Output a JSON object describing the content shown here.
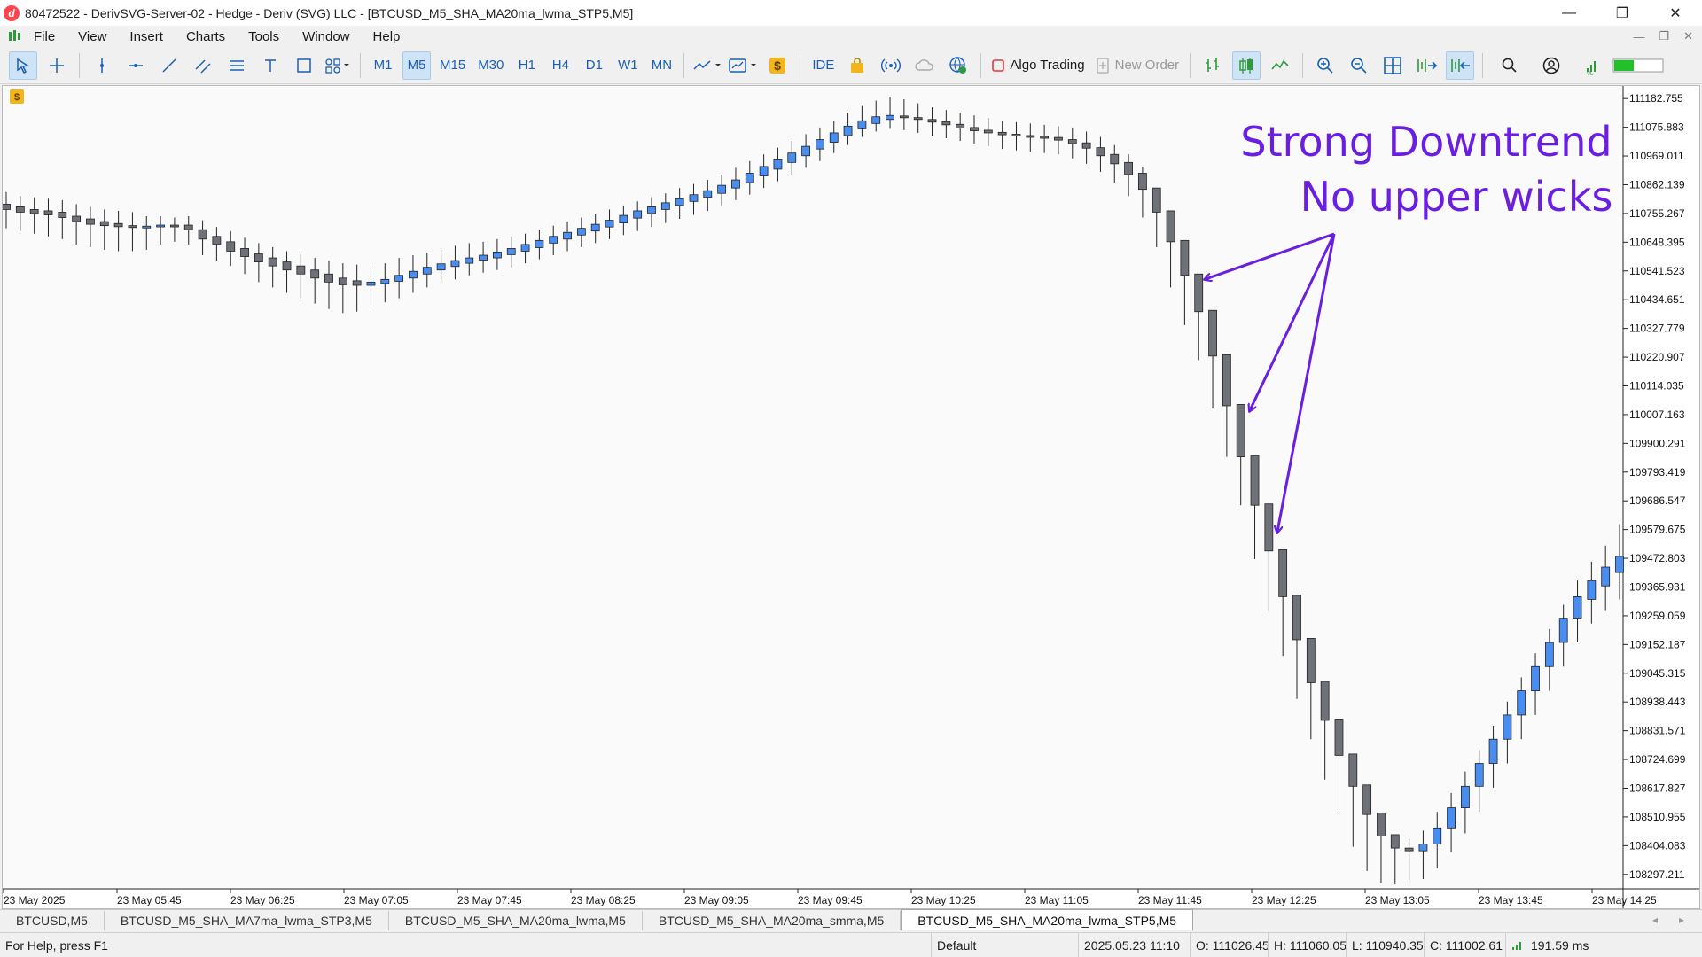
{
  "window": {
    "title": "80472522 - DerivSVG-Server-02 - Hedge - Deriv (SVG) LLC - [BTCUSD_M5_SHA_MA20ma_lwma_STP5,M5]",
    "minimize": "—",
    "restore": "❐",
    "close": "✕"
  },
  "menu": {
    "items": [
      "File",
      "View",
      "Insert",
      "Charts",
      "Tools",
      "Window",
      "Help"
    ],
    "mdi_min": "—",
    "mdi_restore": "❐",
    "mdi_close": "✕"
  },
  "toolbar": {
    "timeframes": [
      "M1",
      "M5",
      "M15",
      "M30",
      "H1",
      "H4",
      "D1",
      "W1",
      "MN"
    ],
    "active_timeframe": "M5",
    "ide_label": "IDE",
    "algo_trading_label": "Algo Trading",
    "new_order_label": "New Order",
    "colors": {
      "accent": "#1a5fb4",
      "algo_red": "#e53935",
      "green": "#2e9b3a"
    }
  },
  "chart_data": {
    "type": "candlestick",
    "symbol": "BTCUSD",
    "timeframe": "M5",
    "y_ticks": [
      "111182.755",
      "111075.883",
      "110969.011",
      "110862.139",
      "110755.267",
      "110648.395",
      "110541.523",
      "110434.651",
      "110327.779",
      "110220.907",
      "110114.035",
      "110007.163",
      "109900.291",
      "109793.419",
      "109686.547",
      "109579.675",
      "109472.803",
      "109365.931",
      "109259.059",
      "109152.187",
      "109045.315",
      "108938.443",
      "108831.571",
      "108724.699",
      "108617.827",
      "108510.955",
      "108404.083",
      "108297.211"
    ],
    "ylim": [
      108243.775,
      111229.5
    ],
    "x_ticks": [
      "23 May 2025",
      "23 May 05:45",
      "23 May 06:25",
      "23 May 07:05",
      "23 May 07:45",
      "23 May 08:25",
      "23 May 09:05",
      "23 May 09:45",
      "23 May 10:25",
      "23 May 11:05",
      "23 May 11:45",
      "23 May 12:25",
      "23 May 13:05",
      "23 May 13:45",
      "23 May 14:25"
    ],
    "up_color": "#4a8df0",
    "down_color": "#6f7178",
    "candles": [
      {
        "o": 110790,
        "h": 110835,
        "l": 110700,
        "c": 110770
      },
      {
        "o": 110780,
        "h": 110820,
        "l": 110690,
        "c": 110760
      },
      {
        "o": 110770,
        "h": 110815,
        "l": 110680,
        "c": 110755
      },
      {
        "o": 110765,
        "h": 110810,
        "l": 110670,
        "c": 110750
      },
      {
        "o": 110760,
        "h": 110805,
        "l": 110660,
        "c": 110740
      },
      {
        "o": 110745,
        "h": 110790,
        "l": 110640,
        "c": 110725
      },
      {
        "o": 110735,
        "h": 110780,
        "l": 110630,
        "c": 110715
      },
      {
        "o": 110725,
        "h": 110770,
        "l": 110620,
        "c": 110710
      },
      {
        "o": 110718,
        "h": 110765,
        "l": 110615,
        "c": 110706
      },
      {
        "o": 110710,
        "h": 110760,
        "l": 110615,
        "c": 110703
      },
      {
        "o": 110703,
        "h": 110745,
        "l": 110620,
        "c": 110708
      },
      {
        "o": 110706,
        "h": 110745,
        "l": 110640,
        "c": 110712
      },
      {
        "o": 110712,
        "h": 110740,
        "l": 110650,
        "c": 110710
      },
      {
        "o": 110712,
        "h": 110745,
        "l": 110640,
        "c": 110695
      },
      {
        "o": 110695,
        "h": 110730,
        "l": 110600,
        "c": 110660
      },
      {
        "o": 110670,
        "h": 110705,
        "l": 110580,
        "c": 110640
      },
      {
        "o": 110650,
        "h": 110690,
        "l": 110560,
        "c": 110615
      },
      {
        "o": 110625,
        "h": 110665,
        "l": 110530,
        "c": 110595
      },
      {
        "o": 110605,
        "h": 110645,
        "l": 110500,
        "c": 110575
      },
      {
        "o": 110590,
        "h": 110630,
        "l": 110480,
        "c": 110560
      },
      {
        "o": 110575,
        "h": 110615,
        "l": 110460,
        "c": 110545
      },
      {
        "o": 110560,
        "h": 110605,
        "l": 110440,
        "c": 110530
      },
      {
        "o": 110545,
        "h": 110590,
        "l": 110420,
        "c": 110515
      },
      {
        "o": 110530,
        "h": 110580,
        "l": 110400,
        "c": 110500
      },
      {
        "o": 110515,
        "h": 110570,
        "l": 110385,
        "c": 110490
      },
      {
        "o": 110505,
        "h": 110565,
        "l": 110390,
        "c": 110488
      },
      {
        "o": 110488,
        "h": 110560,
        "l": 110410,
        "c": 110500
      },
      {
        "o": 110495,
        "h": 110570,
        "l": 110425,
        "c": 110510
      },
      {
        "o": 110503,
        "h": 110590,
        "l": 110440,
        "c": 110525
      },
      {
        "o": 110515,
        "h": 110600,
        "l": 110460,
        "c": 110540
      },
      {
        "o": 110530,
        "h": 110610,
        "l": 110480,
        "c": 110555
      },
      {
        "o": 110545,
        "h": 110620,
        "l": 110500,
        "c": 110568
      },
      {
        "o": 110558,
        "h": 110635,
        "l": 110510,
        "c": 110580
      },
      {
        "o": 110570,
        "h": 110645,
        "l": 110525,
        "c": 110590
      },
      {
        "o": 110582,
        "h": 110650,
        "l": 110535,
        "c": 110600
      },
      {
        "o": 110590,
        "h": 110660,
        "l": 110545,
        "c": 110612
      },
      {
        "o": 110602,
        "h": 110670,
        "l": 110555,
        "c": 110625
      },
      {
        "o": 110615,
        "h": 110680,
        "l": 110570,
        "c": 110640
      },
      {
        "o": 110628,
        "h": 110695,
        "l": 110585,
        "c": 110655
      },
      {
        "o": 110645,
        "h": 110710,
        "l": 110600,
        "c": 110670
      },
      {
        "o": 110660,
        "h": 110725,
        "l": 110615,
        "c": 110685
      },
      {
        "o": 110675,
        "h": 110740,
        "l": 110630,
        "c": 110700
      },
      {
        "o": 110690,
        "h": 110755,
        "l": 110645,
        "c": 110715
      },
      {
        "o": 110705,
        "h": 110770,
        "l": 110660,
        "c": 110730
      },
      {
        "o": 110720,
        "h": 110785,
        "l": 110675,
        "c": 110748
      },
      {
        "o": 110738,
        "h": 110800,
        "l": 110690,
        "c": 110765
      },
      {
        "o": 110755,
        "h": 110815,
        "l": 110705,
        "c": 110780
      },
      {
        "o": 110770,
        "h": 110830,
        "l": 110720,
        "c": 110795
      },
      {
        "o": 110785,
        "h": 110850,
        "l": 110735,
        "c": 110810
      },
      {
        "o": 110800,
        "h": 110865,
        "l": 110750,
        "c": 110825
      },
      {
        "o": 110815,
        "h": 110880,
        "l": 110765,
        "c": 110840
      },
      {
        "o": 110830,
        "h": 110900,
        "l": 110785,
        "c": 110860
      },
      {
        "o": 110850,
        "h": 110925,
        "l": 110805,
        "c": 110880
      },
      {
        "o": 110870,
        "h": 110950,
        "l": 110825,
        "c": 110905
      },
      {
        "o": 110895,
        "h": 110975,
        "l": 110850,
        "c": 110930
      },
      {
        "o": 110920,
        "h": 111000,
        "l": 110875,
        "c": 110955
      },
      {
        "o": 110945,
        "h": 111025,
        "l": 110900,
        "c": 110980
      },
      {
        "o": 110970,
        "h": 111050,
        "l": 110925,
        "c": 111005
      },
      {
        "o": 110995,
        "h": 111075,
        "l": 110950,
        "c": 111030
      },
      {
        "o": 111020,
        "h": 111100,
        "l": 110980,
        "c": 111055
      },
      {
        "o": 111045,
        "h": 111130,
        "l": 111010,
        "c": 111080
      },
      {
        "o": 111070,
        "h": 111155,
        "l": 111040,
        "c": 111100
      },
      {
        "o": 111090,
        "h": 111175,
        "l": 111060,
        "c": 111115
      },
      {
        "o": 111105,
        "h": 111190,
        "l": 111070,
        "c": 111120
      },
      {
        "o": 111118,
        "h": 111180,
        "l": 111065,
        "c": 111112
      },
      {
        "o": 111112,
        "h": 111165,
        "l": 111055,
        "c": 111105
      },
      {
        "o": 111105,
        "h": 111150,
        "l": 111045,
        "c": 111095
      },
      {
        "o": 111097,
        "h": 111140,
        "l": 111035,
        "c": 111085
      },
      {
        "o": 111087,
        "h": 111130,
        "l": 111025,
        "c": 111073
      },
      {
        "o": 111075,
        "h": 111120,
        "l": 111015,
        "c": 111063
      },
      {
        "o": 111065,
        "h": 111110,
        "l": 111005,
        "c": 111055
      },
      {
        "o": 111057,
        "h": 111100,
        "l": 110995,
        "c": 111048
      },
      {
        "o": 111050,
        "h": 111095,
        "l": 110990,
        "c": 111043
      },
      {
        "o": 111045,
        "h": 111090,
        "l": 110985,
        "c": 111040
      },
      {
        "o": 111042,
        "h": 111085,
        "l": 110980,
        "c": 111035
      },
      {
        "o": 111038,
        "h": 111080,
        "l": 110975,
        "c": 111028
      },
      {
        "o": 111030,
        "h": 111075,
        "l": 110960,
        "c": 111015
      },
      {
        "o": 111018,
        "h": 111060,
        "l": 110940,
        "c": 110998
      },
      {
        "o": 111000,
        "h": 111040,
        "l": 110910,
        "c": 110970
      },
      {
        "o": 110975,
        "h": 111010,
        "l": 110870,
        "c": 110940
      },
      {
        "o": 110945,
        "h": 110975,
        "l": 110820,
        "c": 110900
      },
      {
        "o": 110905,
        "h": 110930,
        "l": 110740,
        "c": 110845
      },
      {
        "o": 110850,
        "h": 110850,
        "l": 110630,
        "c": 110760
      },
      {
        "o": 110765,
        "h": 110765,
        "l": 110480,
        "c": 110650
      },
      {
        "o": 110655,
        "h": 110655,
        "l": 110340,
        "c": 110525
      },
      {
        "o": 110530,
        "h": 110530,
        "l": 110210,
        "c": 110390
      },
      {
        "o": 110395,
        "h": 110395,
        "l": 110030,
        "c": 110225
      },
      {
        "o": 110230,
        "h": 110230,
        "l": 109850,
        "c": 110040
      },
      {
        "o": 110045,
        "h": 110045,
        "l": 109670,
        "c": 109850
      },
      {
        "o": 109855,
        "h": 109855,
        "l": 109470,
        "c": 109670
      },
      {
        "o": 109675,
        "h": 109675,
        "l": 109280,
        "c": 109500
      },
      {
        "o": 109505,
        "h": 109505,
        "l": 109110,
        "c": 109330
      },
      {
        "o": 109335,
        "h": 109335,
        "l": 108950,
        "c": 109170
      },
      {
        "o": 109175,
        "h": 109175,
        "l": 108800,
        "c": 109010
      },
      {
        "o": 109015,
        "h": 109015,
        "l": 108650,
        "c": 108870
      },
      {
        "o": 108875,
        "h": 108875,
        "l": 108520,
        "c": 108740
      },
      {
        "o": 108745,
        "h": 108745,
        "l": 108400,
        "c": 108625
      },
      {
        "o": 108630,
        "h": 108630,
        "l": 108310,
        "c": 108520
      },
      {
        "o": 108525,
        "h": 108525,
        "l": 108265,
        "c": 108440
      },
      {
        "o": 108445,
        "h": 108445,
        "l": 108260,
        "c": 108395
      },
      {
        "o": 108395,
        "h": 108430,
        "l": 108265,
        "c": 108385
      },
      {
        "o": 108385,
        "h": 108460,
        "l": 108280,
        "c": 108410
      },
      {
        "o": 108410,
        "h": 108530,
        "l": 108320,
        "c": 108470
      },
      {
        "o": 108470,
        "h": 108600,
        "l": 108380,
        "c": 108545
      },
      {
        "o": 108545,
        "h": 108680,
        "l": 108450,
        "c": 108625
      },
      {
        "o": 108625,
        "h": 108760,
        "l": 108530,
        "c": 108710
      },
      {
        "o": 108710,
        "h": 108850,
        "l": 108620,
        "c": 108800
      },
      {
        "o": 108800,
        "h": 108940,
        "l": 108710,
        "c": 108890
      },
      {
        "o": 108890,
        "h": 109030,
        "l": 108800,
        "c": 108980
      },
      {
        "o": 108980,
        "h": 109120,
        "l": 108890,
        "c": 109070
      },
      {
        "o": 109070,
        "h": 109210,
        "l": 108980,
        "c": 109160
      },
      {
        "o": 109160,
        "h": 109300,
        "l": 109070,
        "c": 109250
      },
      {
        "o": 109250,
        "h": 109390,
        "l": 109160,
        "c": 109330
      },
      {
        "o": 109320,
        "h": 109460,
        "l": 109230,
        "c": 109390
      },
      {
        "o": 109370,
        "h": 109520,
        "l": 109280,
        "c": 109440
      },
      {
        "o": 109420,
        "h": 109600,
        "l": 109320,
        "c": 109480
      }
    ],
    "annotation": {
      "line1": "Strong Downtrend",
      "line2": "No upper wicks",
      "color": "#6a1fe0"
    }
  },
  "tabs": {
    "items": [
      "BTCUSD,M5",
      "BTCUSD_M5_SHA_MA7ma_lwma_STP3,M5",
      "BTCUSD_M5_SHA_MA20ma_lwma,M5",
      "BTCUSD_M5_SHA_MA20ma_smma,M5",
      "BTCUSD_M5_SHA_MA20ma_lwma_STP5,M5"
    ],
    "active_index": 4,
    "left_arrow": "◂",
    "right_arrow": "▸"
  },
  "status": {
    "help": "For Help, press F1",
    "profile": "Default",
    "datetime": "2025.05.23 11:10",
    "open": "O: 111026.45",
    "high": "H: 111060.05",
    "low": "L: 110940.35",
    "close": "C: 111002.61",
    "ping": "191.59 ms"
  }
}
